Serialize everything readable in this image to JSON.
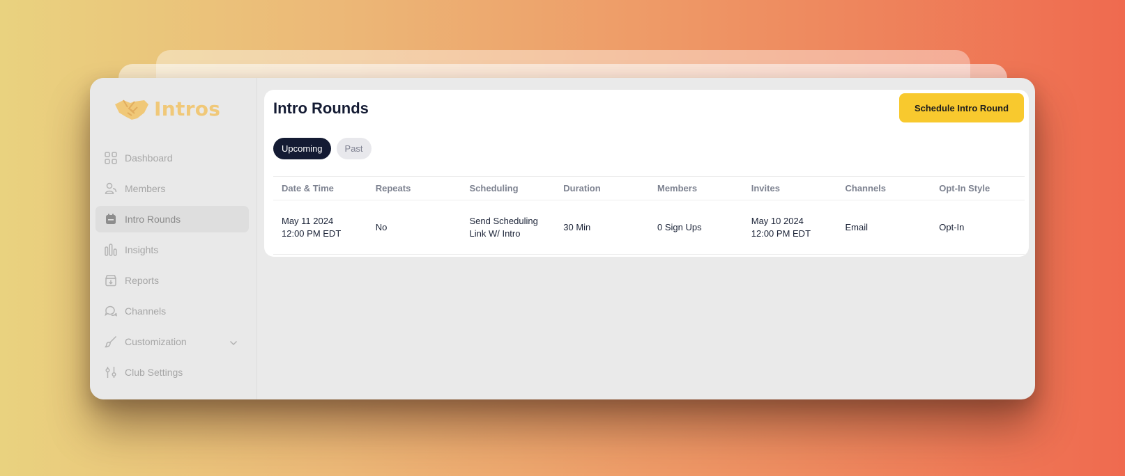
{
  "app": {
    "name": "Intros",
    "colors": {
      "brand": "#f0c878",
      "accent": "#f8c92e",
      "dark": "#141b33"
    }
  },
  "sidebar": {
    "items": [
      {
        "label": "Dashboard",
        "icon": "grid-icon",
        "active": false
      },
      {
        "label": "Members",
        "icon": "members-icon",
        "active": false
      },
      {
        "label": "Intro Rounds",
        "icon": "calendar-icon",
        "active": true
      },
      {
        "label": "Insights",
        "icon": "bar-chart-icon",
        "active": false
      },
      {
        "label": "Reports",
        "icon": "download-box-icon",
        "active": false
      },
      {
        "label": "Channels",
        "icon": "chat-bubbles-icon",
        "active": false
      },
      {
        "label": "Customization",
        "icon": "brush-icon",
        "active": false,
        "has_submenu": true
      },
      {
        "label": "Club Settings",
        "icon": "sliders-icon",
        "active": false
      }
    ]
  },
  "main": {
    "title": "Intro Rounds",
    "primary_action": "Schedule Intro Round",
    "tabs": [
      {
        "label": "Upcoming",
        "selected": true
      },
      {
        "label": "Past",
        "selected": false
      }
    ],
    "table": {
      "columns": [
        "Date & Time",
        "Repeats",
        "Scheduling",
        "Duration",
        "Members",
        "Invites",
        "Channels",
        "Opt-In Style"
      ],
      "rows": [
        {
          "date_line1": "May 11 2024",
          "date_line2": "12:00 PM EDT",
          "repeats": "No",
          "scheduling_line1": "Send Scheduling",
          "scheduling_line2": "Link W/ Intro",
          "duration": "30 Min",
          "members": "0 Sign Ups",
          "invites_line1": "May 10 2024",
          "invites_line2": "12:00 PM EDT",
          "channels": "Email",
          "opt_in_style": "Opt-In"
        }
      ]
    }
  }
}
